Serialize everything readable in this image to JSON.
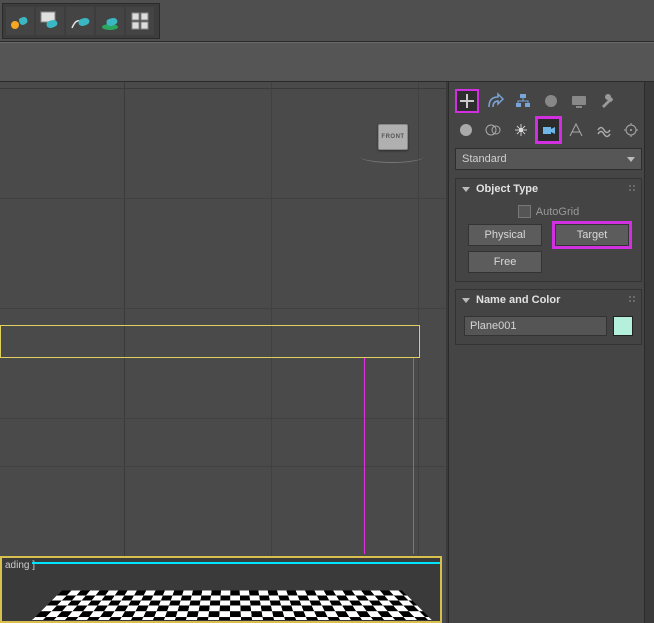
{
  "toolbar": {
    "icons": [
      "teapot-gear-icon",
      "teapot-window-icon",
      "teapot-bounce-icon",
      "teapot-splash-icon",
      "grid-icon"
    ]
  },
  "front_gizmo_label": "FRONT",
  "persp_label": "ading ]",
  "create_panel": {
    "dropdown": "Standard",
    "rollout_object_type": "Object Type",
    "autogrid_label": "AutoGrid",
    "buttons": {
      "physical": "Physical",
      "target": "Target",
      "free": "Free"
    },
    "rollout_name_color": "Name and Color",
    "object_name": "Plane001",
    "color_swatch": "#b4f0dc"
  }
}
